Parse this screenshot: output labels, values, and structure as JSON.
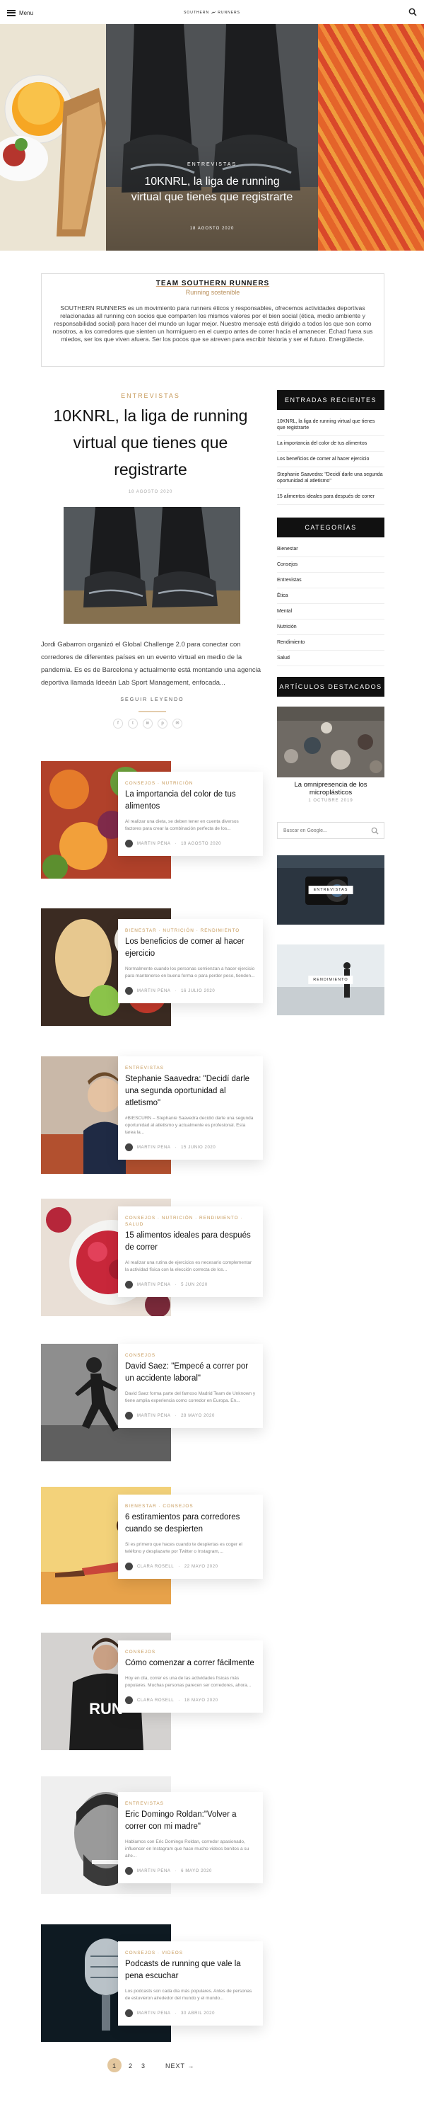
{
  "header": {
    "menu_label": "Menu",
    "logo_left": "SOUTHERN",
    "logo_right": "RUNNERS"
  },
  "hero": {
    "category": "ENTREVISTAS",
    "title": "10KNRL, la liga de running virtual que tienes que registrarte",
    "date": "18 AGOSTO 2020"
  },
  "about": {
    "title": "TEAM SOUTHERN RUNNERS",
    "subtitle": "Running sostenible",
    "text": "SOUTHERN RUNNERS es un movimiento para runners éticos y responsables, ofrecemos actividades deportivas relacionadas all running con socios que comparten los mismos valores por el bien social (ética, medio ambiente y responsabilidad social) para hacer del mundo un lugar mejor. Nuestro mensaje está dirigido a todos los que son como nosotros, a los corredores que sienten un hormiguero en el cuerpo antes de correr hacia el amanecer. Échad fuera sus miedos, ser los que viven afuera. Ser los pocos que se atreven para escribir historia y ser el futuro. Energúllecte."
  },
  "featured": {
    "category": "ENTREVISTAS",
    "title": "10KNRL, la liga de running virtual que tienes que registrarte",
    "date": "18 AGOSTO 2020",
    "excerpt": "Jordi Gabarron organizó el Global Challenge 2.0 para conectar con corredores de diferentes países en un evento virtual en medio de la pandemia. Es es de Barcelona y actualmente está montando una agencia deportiva llamada Ideeán Lab Sport Management, enfocada...",
    "read_more": "SEGUIR LEYENDO",
    "share": [
      "f",
      "t",
      "in",
      "p",
      "✉"
    ]
  },
  "posts": [
    {
      "category": "CONSEJOS · NUTRICIÓN",
      "title": "La importancia del color de tus alimentos",
      "excerpt": "Al realizar una dieta, se deben tener en cuenta diversos factores para crear la combinación perfecta de los...",
      "author": "MARTIN PENA",
      "date": "18 AGOSTO 2020"
    },
    {
      "category": "BIENESTAR · NUTRICIÓN · RENDIMIENTO",
      "title": "Los beneficios de comer al hacer ejercicio",
      "excerpt": "Normalmente cuando los personas comienzan a hacer ejercicio para mantenerse en buena forma o para perder peso, tienden...",
      "author": "MARTIN PENA",
      "date": "16 JULIO 2020"
    },
    {
      "category": "ENTREVISTAS",
      "title": "Stephanie Saavedra: \"Decidí darle una segunda oportunidad al atletismo\"",
      "excerpt": "#BIESCURN – Stephanie Saavedra decidió darle una segunda oportunidad al atletismo y actualmente es profesional. Esta tarea la...",
      "author": "MARTIN PENA",
      "date": "15 JUNIO 2020"
    },
    {
      "category": "CONSEJOS · NUTRICIÓN · RENDIMIENTO · SALUD",
      "title": "15 alimentos ideales para después de correr",
      "excerpt": "Al realizar una rutina de ejercicios es necesario complementar la actividad física con la elección correcta de los...",
      "author": "MARTIN PENA",
      "date": "5 JUN 2020"
    },
    {
      "category": "CONSEJOS",
      "title": "David Saez: \"Empecé a correr por un accidente laboral\"",
      "excerpt": "David Saez forma parte del famoso Madrid Team de Unknown y tiene amplia experiencia como corredor en Europa. En...",
      "author": "MARTIN PENA",
      "date": "28 MAYO 2020"
    },
    {
      "category": "BIENESTAR · CONSEJOS",
      "title": "6 estiramientos para corredores cuando se despierten",
      "excerpt": "Si es primero que haces cuando te despiertas es coger el teléfono y desplazarte por Twitter o Instagram,...",
      "author": "CLARA ROSELL",
      "date": "22 MAYO 2020"
    },
    {
      "category": "CONSEJOS",
      "title": "Cómo comenzar a correr fácilmente",
      "excerpt": "Hoy en día, correr es una de las actividades físicas más populares. Muchas personas parecen ser corredores, ahora...",
      "author": "CLARA ROSELL",
      "date": "18 MAYO 2020"
    },
    {
      "category": "ENTREVISTAS",
      "title": "Eric Domingo Roldan:\"Volver a correr con mi madre\"",
      "excerpt": "Hablamos con Eric Domingo Roldan, corredor apasionado, influencer en Instagram que hace mucho videos bonitos a su alre...",
      "author": "MARTIN PENA",
      "date": "6 MAYO 2020"
    },
    {
      "category": "CONSEJOS · VIDEOS",
      "title": "Podcasts de running que vale la pena escuchar",
      "excerpt": "Los podcasts son cada día más populares. Antes de personas de estuvieron alrededor del mundo y el mundo...",
      "author": "MARTIN PENA",
      "date": "30 ABRIL 2020"
    }
  ],
  "sidebar": {
    "recent_title": "ENTRADAS RECIENTES",
    "recent": [
      "10KNRL, la liga de running virtual que tienes que registrarte",
      "La importancia del color de tus alimentos",
      "Los beneficios de comer al hacer ejercicio",
      "Stephanie Saavedra: \"Decidí darle una segunda oportunidad al atletismo\"",
      "15 alimentos ideales para después de correr"
    ],
    "categories_title": "CATEGORÍAS",
    "categories": [
      "Bienestar",
      "Consejos",
      "Entrevistas",
      "Ética",
      "Mental",
      "Nutrición",
      "Rendimiento",
      "Salud"
    ],
    "featured_title": "ARTÍCULOS DESTACADOS",
    "featured_post_title": "La omnipresencia de los microplásticos",
    "featured_post_date": "1 OCTUBRE 2019",
    "search_placeholder": "Buscar en Google...",
    "badge1": "ENTREVISTAS",
    "badge2": "RENDIMIENTO"
  },
  "pagination": {
    "pages": [
      "1",
      "2",
      "3"
    ],
    "next": "NEXT →"
  },
  "colors": {
    "accent": "#c79a5a",
    "dark": "#111111"
  }
}
